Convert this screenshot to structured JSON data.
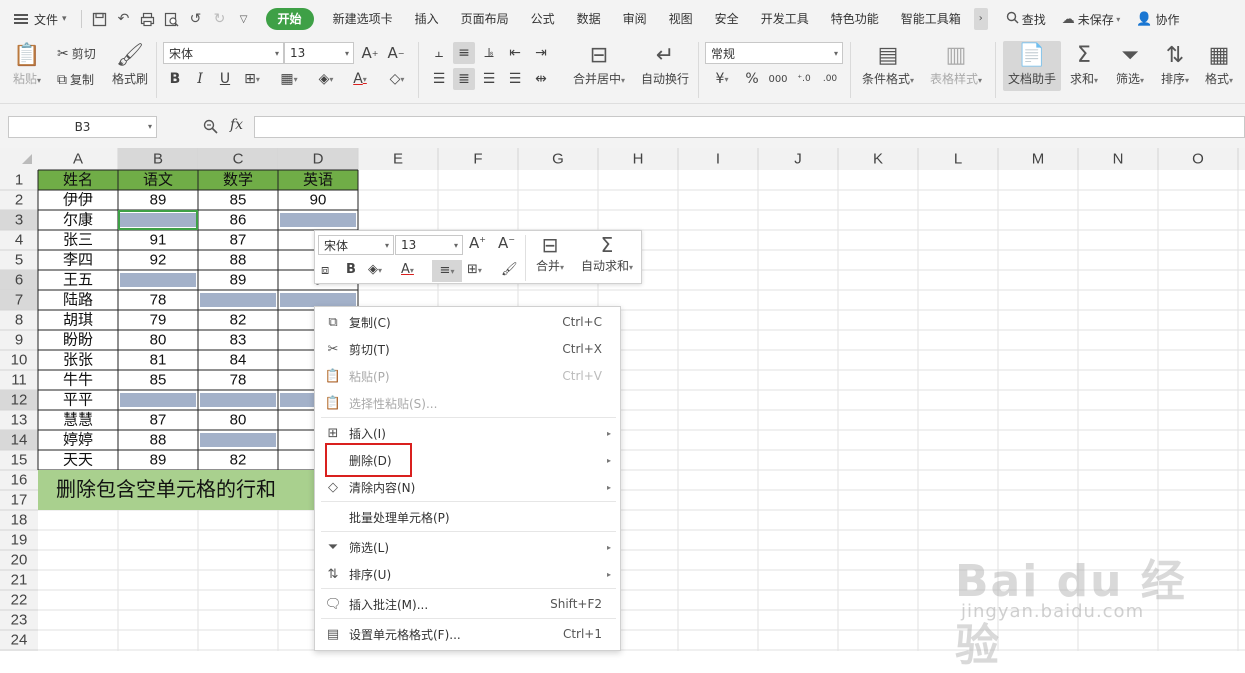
{
  "menubar": {
    "file_label": "文件",
    "tabs": [
      "开始",
      "新建选项卡",
      "插入",
      "页面布局",
      "公式",
      "数据",
      "审阅",
      "视图",
      "安全",
      "开发工具",
      "特色功能",
      "智能工具箱"
    ],
    "active_tab": "开始",
    "search_label": "查找",
    "save_status": "未保存",
    "collab_label": "协作"
  },
  "ribbon": {
    "paste": "粘贴",
    "cut": "剪切",
    "copy": "复制",
    "format_painter": "格式刷",
    "font_name": "宋体",
    "font_size": "13",
    "merge_center": "合并居中",
    "wrap_text": "自动换行",
    "number_format": "常规",
    "conditional_format": "条件格式",
    "table_style": "表格样式",
    "doc_assistant": "文档助手",
    "sum": "求和",
    "filter": "筛选",
    "sort": "排序",
    "format": "格式"
  },
  "formula_bar": {
    "name_box": "B3",
    "fx_label": "fx",
    "formula": ""
  },
  "sheet": {
    "columns": [
      "A",
      "B",
      "C",
      "D",
      "E",
      "F",
      "G",
      "H",
      "I",
      "J",
      "K",
      "L",
      "M",
      "N",
      "O"
    ],
    "rows": [
      "1",
      "2",
      "3",
      "4",
      "5",
      "6",
      "7",
      "8",
      "9",
      "10",
      "11",
      "12",
      "13",
      "14",
      "15",
      "16",
      "17",
      "18",
      "19",
      "20",
      "21",
      "22",
      "23",
      "24"
    ],
    "header": [
      "姓名",
      "语文",
      "数学",
      "英语"
    ],
    "data": [
      [
        "伊伊",
        "89",
        "85",
        "90"
      ],
      [
        "尔康",
        "",
        "86",
        ""
      ],
      [
        "张三",
        "91",
        "87",
        "9"
      ],
      [
        "李四",
        "92",
        "88",
        "9"
      ],
      [
        "王五",
        "",
        "89",
        "9"
      ],
      [
        "陆路",
        "78",
        "",
        ""
      ],
      [
        "胡琪",
        "79",
        "82",
        "7"
      ],
      [
        "盼盼",
        "80",
        "83",
        "7"
      ],
      [
        "张张",
        "81",
        "84",
        "7"
      ],
      [
        "牛牛",
        "85",
        "78",
        "8"
      ],
      [
        "平平",
        "",
        "",
        ""
      ],
      [
        "慧慧",
        "87",
        "80",
        "8"
      ],
      [
        "婷婷",
        "88",
        "",
        "8"
      ],
      [
        "天天",
        "89",
        "82",
        "8"
      ]
    ],
    "blank_cells": [
      [
        1,
        1
      ],
      [
        1,
        3
      ],
      [
        4,
        1
      ],
      [
        5,
        2
      ],
      [
        5,
        3
      ],
      [
        10,
        1
      ],
      [
        10,
        2
      ],
      [
        10,
        3
      ],
      [
        12,
        2
      ]
    ],
    "banner": "删除包含空单元格的行和",
    "colors": {
      "header_fill": "#70ad47",
      "blank_fill": "#a3b1c9",
      "banner_fill": "#a9d08e",
      "grid_line": "#e2e2e2",
      "header_bg": "#f2f2f2",
      "selected_header_bg": "#d8d8d8",
      "selected_row_text": "#3a9b42"
    }
  },
  "mini_toolbar": {
    "font_name": "宋体",
    "font_size": "13",
    "merge": "合并",
    "autosum": "自动求和"
  },
  "context_menu": {
    "items": [
      {
        "label": "复制(C)",
        "shortcut": "Ctrl+C",
        "icon": "copy-icon",
        "disabled": false,
        "submenu": false
      },
      {
        "label": "剪切(T)",
        "shortcut": "Ctrl+X",
        "icon": "scissors-icon",
        "disabled": false,
        "submenu": false
      },
      {
        "label": "粘贴(P)",
        "shortcut": "Ctrl+V",
        "icon": "paste-icon",
        "disabled": true,
        "submenu": false
      },
      {
        "label": "选择性粘贴(S)...",
        "shortcut": "",
        "icon": "paste-special-icon",
        "disabled": true,
        "submenu": false
      },
      {
        "label": "插入(I)",
        "shortcut": "",
        "icon": "insert-icon",
        "disabled": false,
        "submenu": true
      },
      {
        "label": "删除(D)",
        "shortcut": "",
        "icon": "",
        "disabled": false,
        "submenu": true
      },
      {
        "label": "清除内容(N)",
        "shortcut": "",
        "icon": "eraser-icon",
        "disabled": false,
        "submenu": true
      },
      {
        "label": "批量处理单元格(P)",
        "shortcut": "",
        "icon": "",
        "disabled": false,
        "submenu": false
      },
      {
        "label": "筛选(L)",
        "shortcut": "",
        "icon": "filter-icon",
        "disabled": false,
        "submenu": true
      },
      {
        "label": "排序(U)",
        "shortcut": "",
        "icon": "sort-icon",
        "disabled": false,
        "submenu": true
      },
      {
        "label": "插入批注(M)...",
        "shortcut": "Shift+F2",
        "icon": "comment-icon",
        "disabled": false,
        "submenu": false
      },
      {
        "label": "设置单元格格式(F)...",
        "shortcut": "Ctrl+1",
        "icon": "format-cells-icon",
        "disabled": false,
        "submenu": false
      }
    ],
    "highlighted": "删除(D)"
  },
  "watermark": {
    "line1": "Bai du 经验",
    "line2": "jingyan.baidu.com"
  }
}
